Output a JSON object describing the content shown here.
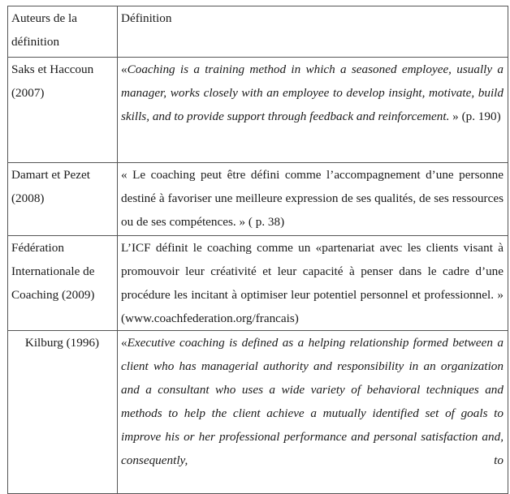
{
  "table": {
    "headers": {
      "author": "Auteurs de la définition",
      "definition": "Définition"
    },
    "rows": [
      {
        "author": "Saks et Haccoun (2007)",
        "quote_open": "«",
        "definition_italic": "Coaching is a training method in which a seasoned employee, usually a manager, works closely with an employee to develop insight, motivate, build skills, and to provide support through feedback and reinforcement.",
        "definition_plain": " » (p. 190)"
      },
      {
        "author": "Damart et Pezet (2008)",
        "definition_plain": "« Le coaching peut être défini comme l’accompagnement d’une personne destiné à favoriser une meilleure expression de ses qualités, de ses ressources ou de ses compétences. » ( p. 38)"
      },
      {
        "author": "Fédération Internationale de Coaching (2009)",
        "definition_plain": "L’ICF définit le coaching comme un «partenariat avec les clients visant à promouvoir leur créativité et leur capacité à penser dans le cadre d’une procédure les incitant à optimiser leur potentiel personnel et professionnel. » (www.coachfederation.org/francais)"
      },
      {
        "author": "Kilburg (1996)",
        "quote_open": "«",
        "definition_italic": "Executive coaching is defined as a helping relationship formed between a client who has managerial authority and responsibility in an organization and a consultant who uses a wide variety of behavioral techniques and methods to help the client achieve a mutually identified set of goals to improve his or her professional performance and personal satisfaction and, consequently, to"
      }
    ]
  }
}
